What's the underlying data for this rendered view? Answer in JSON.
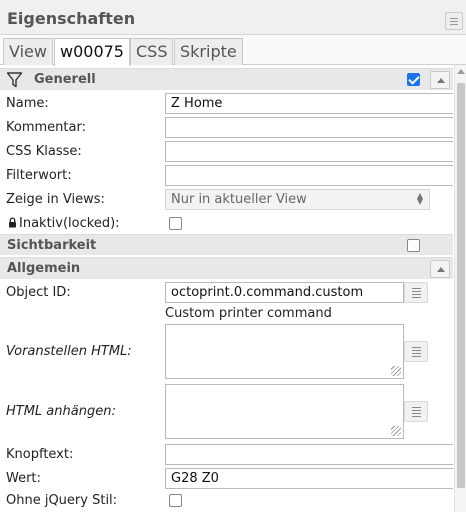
{
  "panel": {
    "title": "Eigenschaften"
  },
  "tabs": [
    {
      "label": "View"
    },
    {
      "label": "w00075"
    },
    {
      "label": "CSS"
    },
    {
      "label": "Skripte"
    }
  ],
  "groups": {
    "general": {
      "title": "Generell",
      "enabled": true
    },
    "visibility": {
      "title": "Sichtbarkeit",
      "enabled": false
    },
    "common": {
      "title": "Allgemein"
    }
  },
  "fields": {
    "name": {
      "label": "Name:",
      "value": "Z Home"
    },
    "comment": {
      "label": "Kommentar:",
      "value": ""
    },
    "css_class": {
      "label": "CSS Klasse:",
      "value": ""
    },
    "filter_word": {
      "label": "Filterwort:",
      "value": ""
    },
    "show_in_views": {
      "label": "Zeige in Views:",
      "value": "Nur in aktueller View"
    },
    "inactive": {
      "label": "Inaktiv(locked):",
      "checked": false
    },
    "object_id": {
      "label": "Object ID:",
      "value": "octoprint.0.command.custom",
      "description": "Custom printer command"
    },
    "prepend_html": {
      "label": "Voranstellen HTML:",
      "value": ""
    },
    "append_html": {
      "label": "HTML anhängen:",
      "value": ""
    },
    "button_text": {
      "label": "Knopftext:",
      "value": ""
    },
    "value": {
      "label": "Wert:",
      "value": "G28 Z0"
    },
    "no_jquery_style": {
      "label": "Ohne jQuery Stil:",
      "checked": false
    }
  },
  "icons": {
    "filter": "filter-icon",
    "lock": "lock-icon",
    "menu": "menu-icon",
    "collapse": "chevron-up-icon",
    "object_picker": "list-icon"
  },
  "colors": {
    "accent": "#1a73e8",
    "group_bg": "#e8e8e8"
  }
}
